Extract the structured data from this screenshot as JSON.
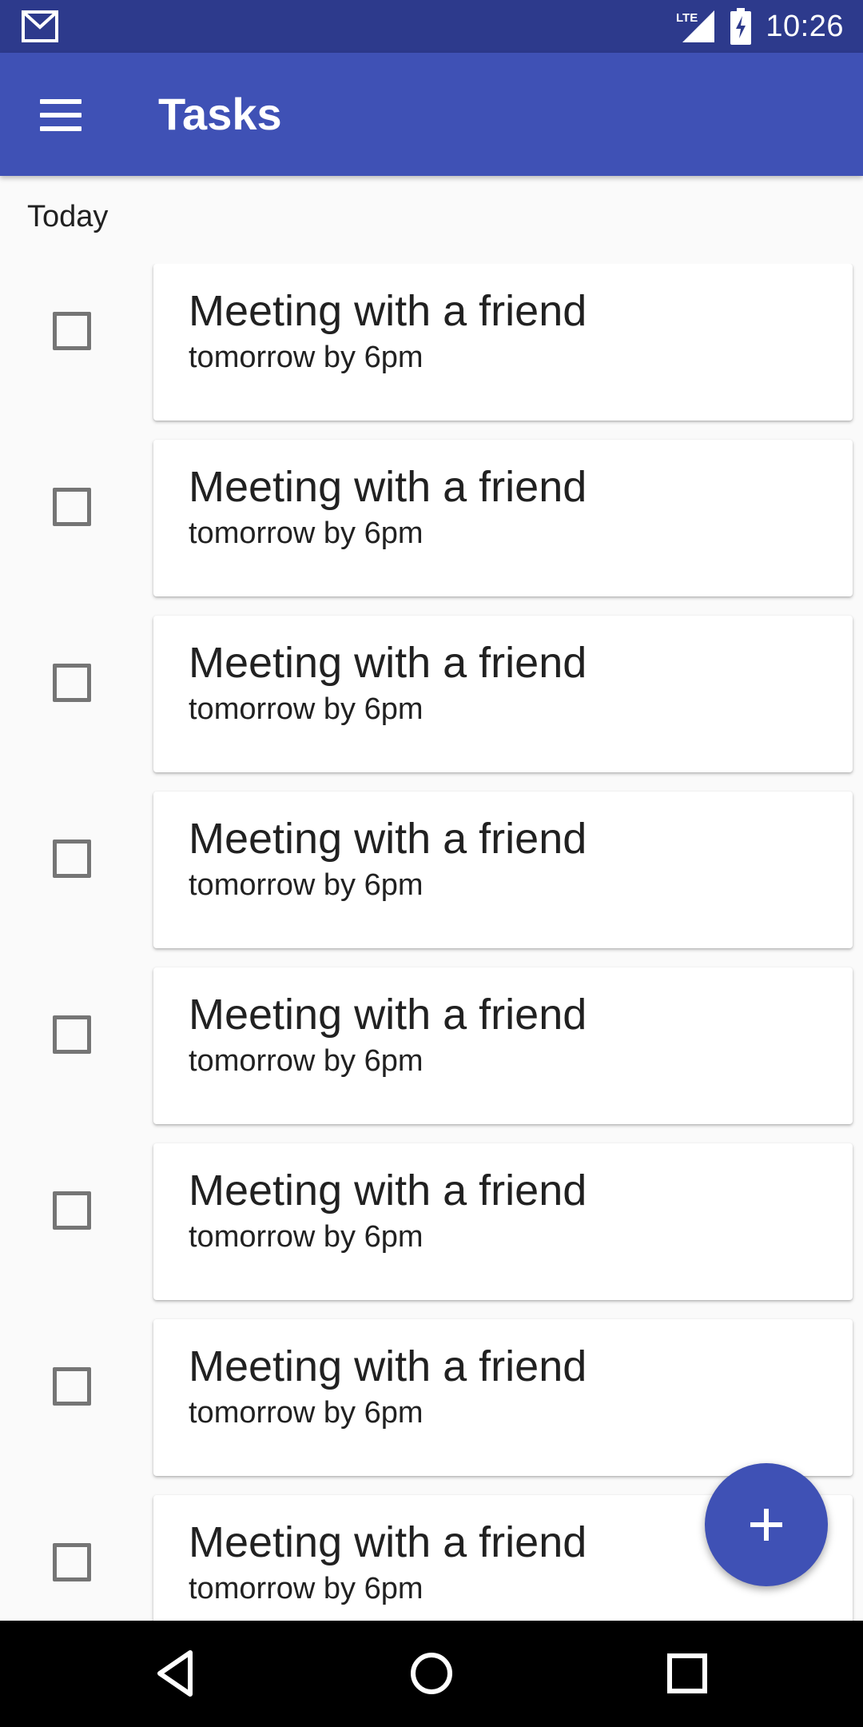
{
  "status_bar": {
    "time": "10:26",
    "network": "LTE",
    "icons": [
      "gmail-icon",
      "signal-icon",
      "battery-charging-icon"
    ]
  },
  "app_bar": {
    "title": "Tasks",
    "menu_icon": "menu-icon"
  },
  "section": {
    "label": "Today"
  },
  "tasks": [
    {
      "title": "Meeting with a friend",
      "subtitle": "tomorrow by 6pm",
      "checked": false
    },
    {
      "title": "Meeting with a friend",
      "subtitle": "tomorrow by 6pm",
      "checked": false
    },
    {
      "title": "Meeting with a friend",
      "subtitle": "tomorrow by 6pm",
      "checked": false
    },
    {
      "title": "Meeting with a friend",
      "subtitle": "tomorrow by 6pm",
      "checked": false
    },
    {
      "title": "Meeting with a friend",
      "subtitle": "tomorrow by 6pm",
      "checked": false
    },
    {
      "title": "Meeting with a friend",
      "subtitle": "tomorrow by 6pm",
      "checked": false
    },
    {
      "title": "Meeting with a friend",
      "subtitle": "tomorrow by 6pm",
      "checked": false
    },
    {
      "title": "Meeting with a friend",
      "subtitle": "tomorrow by 6pm",
      "checked": false
    }
  ],
  "fab": {
    "icon": "add-icon"
  },
  "nav_bar": {
    "icons": [
      "back-icon",
      "home-icon",
      "recents-icon"
    ]
  },
  "colors": {
    "primary": "#3f51b5",
    "primary_dark": "#2d3a8c",
    "background": "#fafafa"
  }
}
